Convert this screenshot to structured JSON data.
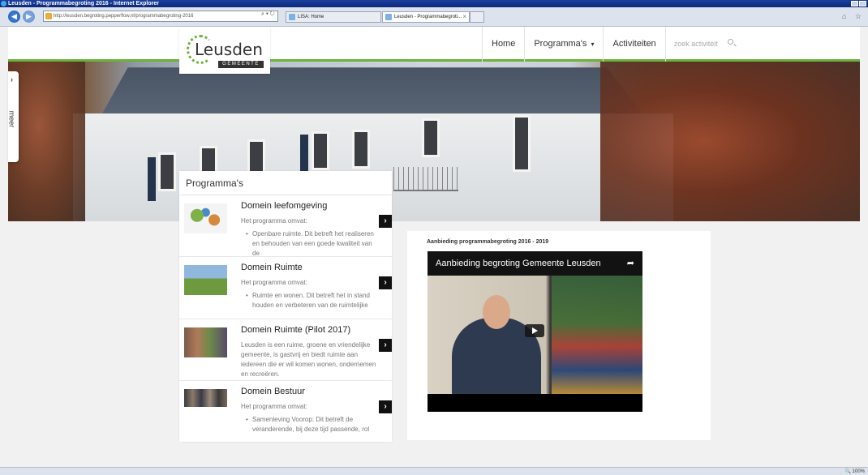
{
  "window": {
    "title": "Leusden - Programmabegroting 2016 - Internet Explorer",
    "address": "http://leusden.begroting.pepperflow.nl/programmabegroting-2016",
    "addr_tools": "⌕ ▾  ↻",
    "tabs": [
      {
        "label": "LISA: Home"
      },
      {
        "label": "Leusden - Programmabegroti...",
        "close": "×"
      }
    ],
    "back_glyph": "◀",
    "forward_glyph": "▶",
    "right_icons": "⌂ ☆",
    "zoom": "🔍 100%"
  },
  "site": {
    "logo_text": "Leusden",
    "logo_sub": "GEMEENTE",
    "nav": {
      "home": "Home",
      "programmas": "Programma's",
      "programmas_caret": "▾",
      "activiteiten": "Activiteiten",
      "search_placeholder": "zoek activiteit"
    },
    "side_tab": {
      "chevron": "›",
      "label": "meer"
    }
  },
  "programmas": {
    "title": "Programma's",
    "arrow": "›",
    "items": [
      {
        "title": "Domein leefomgeving",
        "sub": "Het programma omvat:",
        "bullet": "Openbare ruimte. Dit betreft het realiseren en behouden van een goede kwaliteit van de"
      },
      {
        "title": "Domein Ruimte",
        "sub": "Het programma omvat:",
        "bullet": "Ruimte en wonen. Dit betreft het in stand houden en verbeteren van de ruimtelijke"
      },
      {
        "title": "Domein Ruimte (Pilot 2017)",
        "desc": "Leusden is een ruime, groene en vriendelijke gemeente, is gastvrij en biedt ruimte aan iedereen die er wil komen wonen, ondernemen en recreëren."
      },
      {
        "title": "Domein Bestuur",
        "sub": "Het programma omvat:",
        "bullet": "Samenleving Voorop: Dit betreft de veranderende, bij deze tijd passende, rol"
      }
    ]
  },
  "video": {
    "label": "Aanbieding programmabegroting 2016 - 2019",
    "title": "Aanbieding begroting Gemeente Leusden",
    "share_glyph": "➦"
  },
  "colors": {
    "accent_green": "#6bb33a",
    "ie_titlebar": "#1b3f9f",
    "arrow_button": "#111111"
  }
}
